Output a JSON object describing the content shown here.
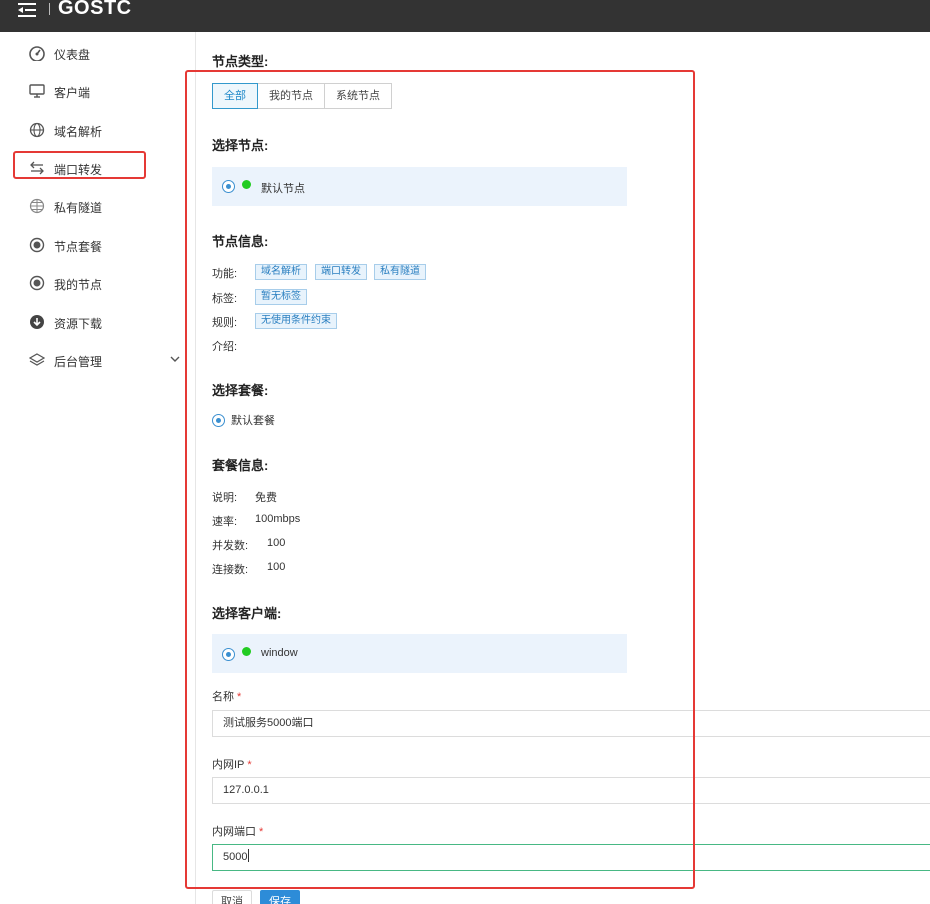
{
  "app": {
    "title": "GOSTC"
  },
  "sidebar": {
    "items": [
      {
        "label": "仪表盘",
        "icon": "dashboard-icon"
      },
      {
        "label": "客户端",
        "icon": "monitor-icon"
      },
      {
        "label": "域名解析",
        "icon": "globe-icon"
      },
      {
        "label": "端口转发",
        "icon": "swap-arrows-icon"
      },
      {
        "label": "私有隧道",
        "icon": "network-globe-icon"
      },
      {
        "label": "节点套餐",
        "icon": "radio-dot-icon"
      },
      {
        "label": "我的节点",
        "icon": "radio-dot-icon"
      },
      {
        "label": "资源下载",
        "icon": "download-icon"
      },
      {
        "label": "后台管理",
        "icon": "layers-icon"
      }
    ]
  },
  "form": {
    "node_type": {
      "title": "节点类型:",
      "options": [
        "全部",
        "我的节点",
        "系统节点"
      ],
      "selected": "全部"
    },
    "select_node": {
      "title": "选择节点:",
      "option_label": "默认节点"
    },
    "node_info": {
      "title": "节点信息:",
      "function_label": "功能:",
      "functions": [
        "域名解析",
        "端口转发",
        "私有隧道"
      ],
      "tags_label": "标签:",
      "tags": [
        "暂无标签"
      ],
      "rules_label": "规则:",
      "rules": [
        "无使用条件约束"
      ],
      "intro_label": "介绍:"
    },
    "select_package": {
      "title": "选择套餐:",
      "option_label": "默认套餐"
    },
    "package_info": {
      "title": "套餐信息:",
      "desc_label": "说明:",
      "desc_value": "免费",
      "rate_label": "速率:",
      "rate_value": "100mbps",
      "concurrency_label": "并发数:",
      "concurrency_value": "100",
      "connections_label": "连接数:",
      "connections_value": "100"
    },
    "select_client": {
      "title": "选择客户端:",
      "option_label": "window"
    },
    "name": {
      "label": "名称",
      "value": "测试服务5000端口"
    },
    "internal_ip": {
      "label": "内网IP",
      "value": "127.0.0.1"
    },
    "internal_port": {
      "label": "内网端口",
      "value": "5000"
    },
    "required_mark": "*",
    "cancel_label": "取消",
    "save_label": "保存"
  },
  "colors": {
    "accent": "#2d8cd8",
    "highlight_red": "#e53935",
    "online_green": "#22cc22",
    "topbar": "#333333"
  }
}
